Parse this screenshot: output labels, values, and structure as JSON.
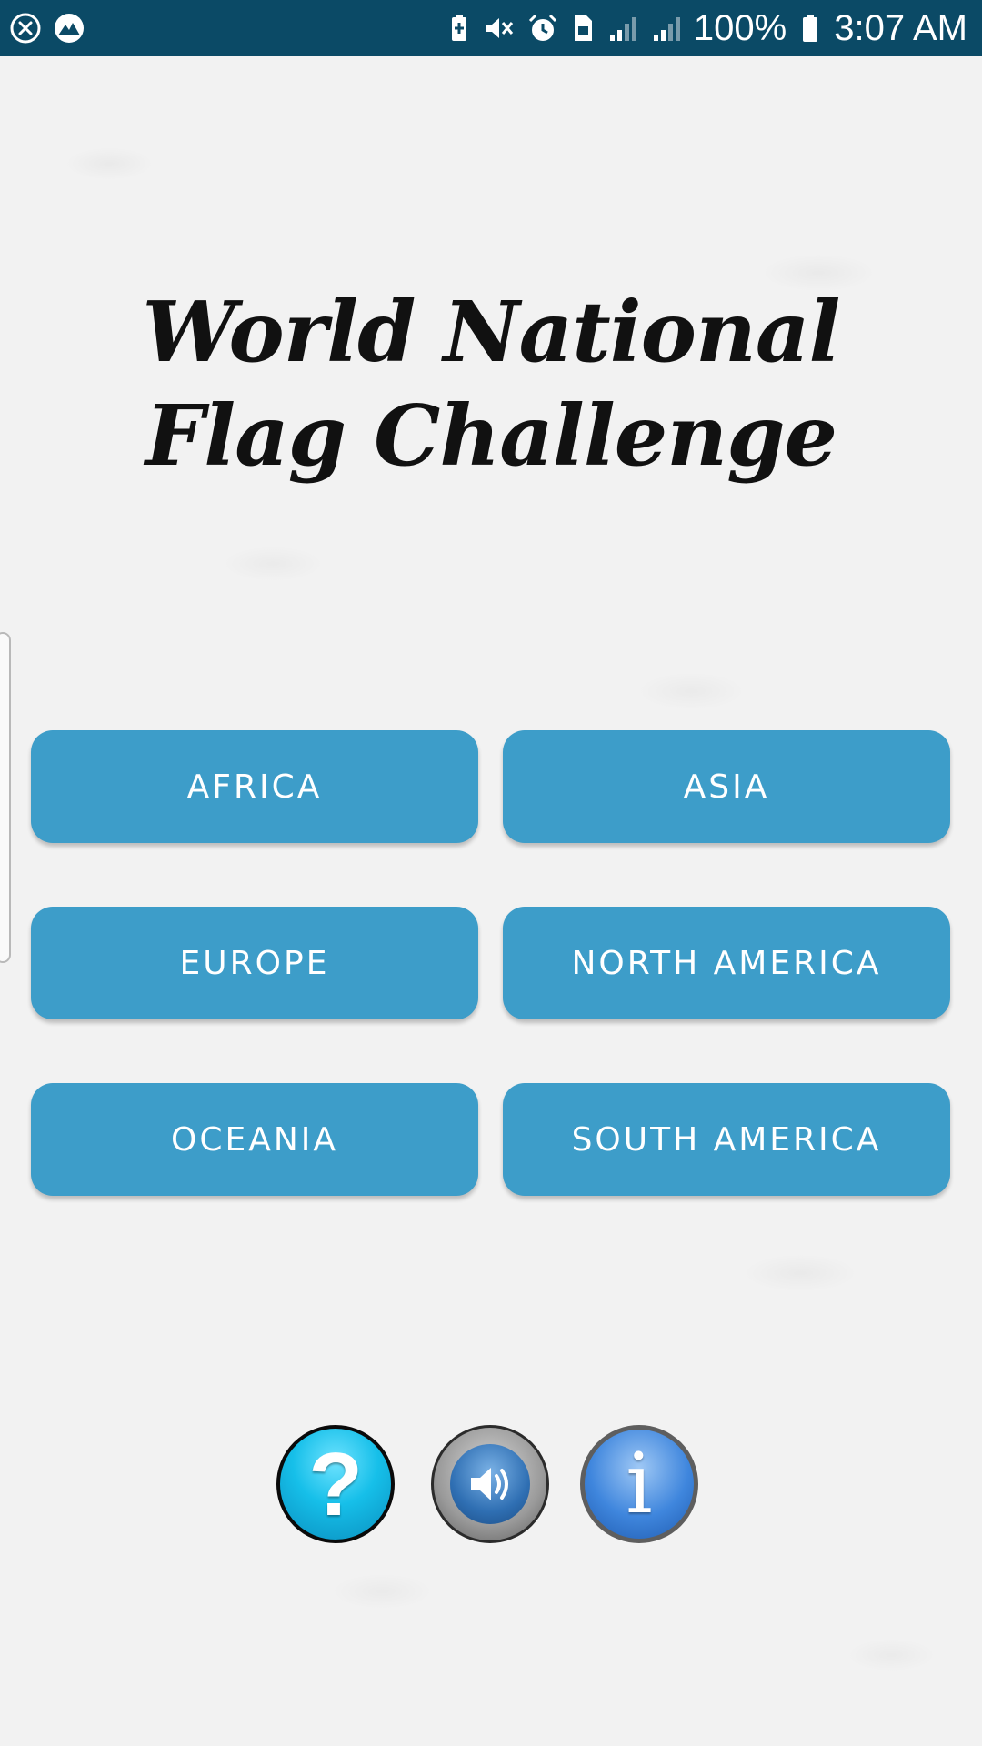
{
  "status_bar": {
    "battery_percent": "100%",
    "time": "3:07 AM",
    "left_icons": [
      "close-circle-icon",
      "mountain-app-icon"
    ],
    "right_icons": [
      "battery-saver-icon",
      "mute-icon",
      "alarm-icon",
      "sim-icon",
      "signal-icon",
      "signal-2-icon",
      "battery-icon"
    ]
  },
  "title": "World National Flag Challenge",
  "regions": {
    "africa": "AFRICA",
    "asia": "ASIA",
    "europe": "EUROPE",
    "north_america": "NORTH AMERICA",
    "oceania": "OCEANIA",
    "south_america": "SOUTH AMERICA"
  },
  "bottom_buttons": {
    "help_glyph": "?",
    "info_glyph": "i",
    "sound_icon": "speaker-icon"
  },
  "colors": {
    "status_bar": "#0b4a66",
    "button_blue": "#3d9dc9",
    "background": "#f2f2f2",
    "title": "#111111"
  }
}
